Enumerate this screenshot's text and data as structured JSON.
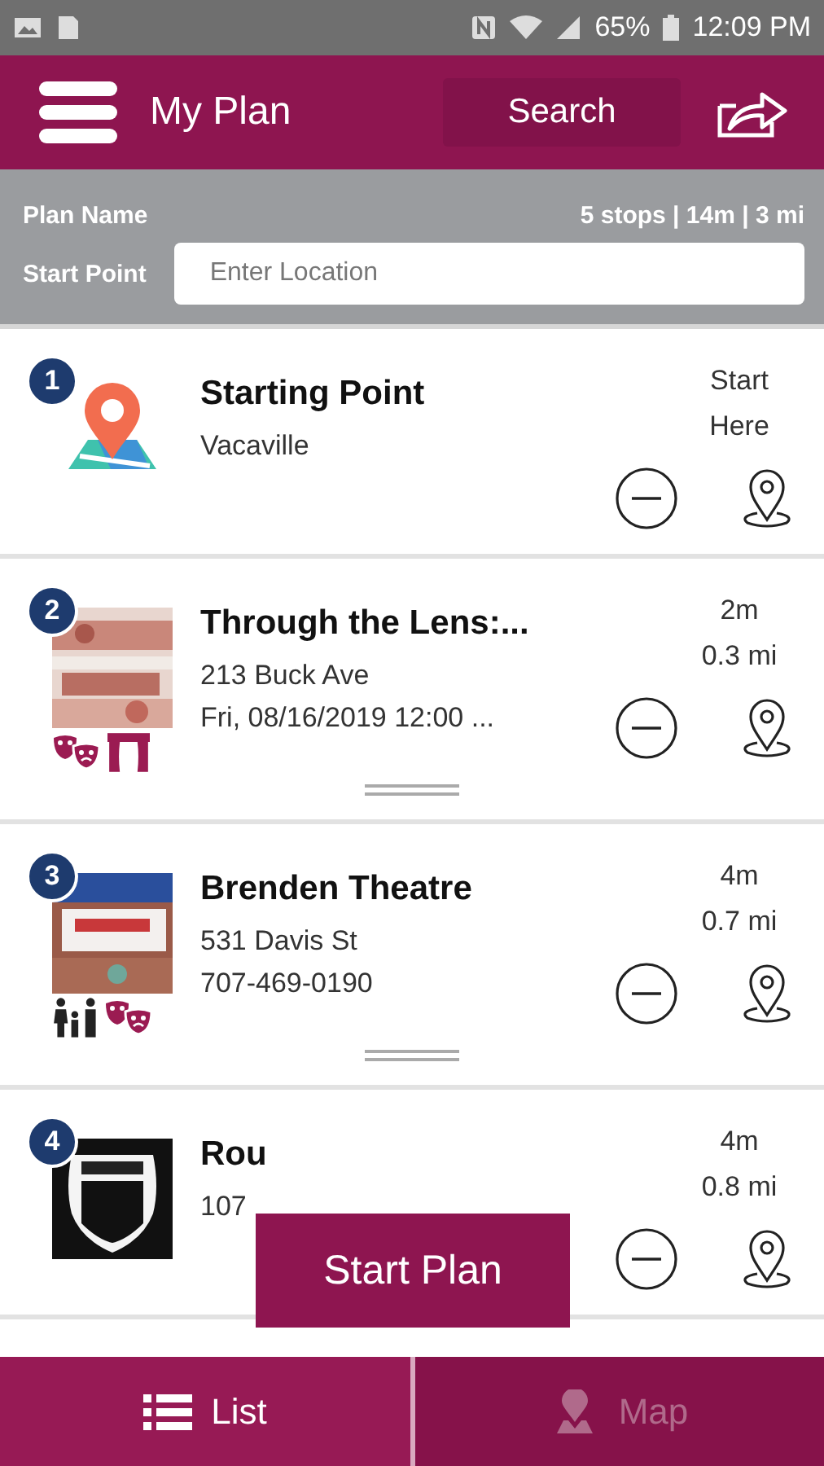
{
  "status_bar": {
    "battery": "65%",
    "time": "12:09 PM"
  },
  "header": {
    "title": "My Plan",
    "search_button": "Search"
  },
  "plan": {
    "name_label": "Plan Name",
    "summary": "5 stops | 14m | 3 mi",
    "start_label": "Start Point",
    "start_field": {
      "placeholder": "Enter Location"
    }
  },
  "stops": [
    {
      "number": "1",
      "image": {
        "kind": "map-pin"
      },
      "title": "Starting Point",
      "lines": [
        "Vacaville"
      ],
      "right": [
        "Start",
        "Here"
      ],
      "draggable": false
    },
    {
      "number": "2",
      "image": {
        "kind": "picture"
      },
      "title": "Through the Lens:...",
      "lines": [
        "213 Buck Ave",
        "Fri, 08/16/2019 12:00 ..."
      ],
      "right": [
        "2m",
        "0.3 mi"
      ],
      "badges": [
        {
          "kind": "masks"
        },
        {
          "kind": "stage"
        }
      ],
      "draggable": true
    },
    {
      "number": "3",
      "image": {
        "kind": "picture"
      },
      "title": "Brenden Theatre",
      "lines": [
        "531 Davis St",
        "707-469-0190"
      ],
      "right": [
        "4m",
        "0.7 mi"
      ],
      "badges": [
        {
          "kind": "family"
        },
        {
          "kind": "masks"
        }
      ],
      "draggable": true
    },
    {
      "number": "4",
      "image": {
        "kind": "picture"
      },
      "title": "Rou",
      "lines": [
        "107"
      ],
      "right": [
        "4m",
        "0.8 mi"
      ],
      "draggable": false
    }
  ],
  "start_button": "Start Plan",
  "tabs": [
    {
      "label": "List",
      "kind": "list",
      "selected": true
    },
    {
      "label": "Map",
      "kind": "map",
      "selected": false
    }
  ]
}
